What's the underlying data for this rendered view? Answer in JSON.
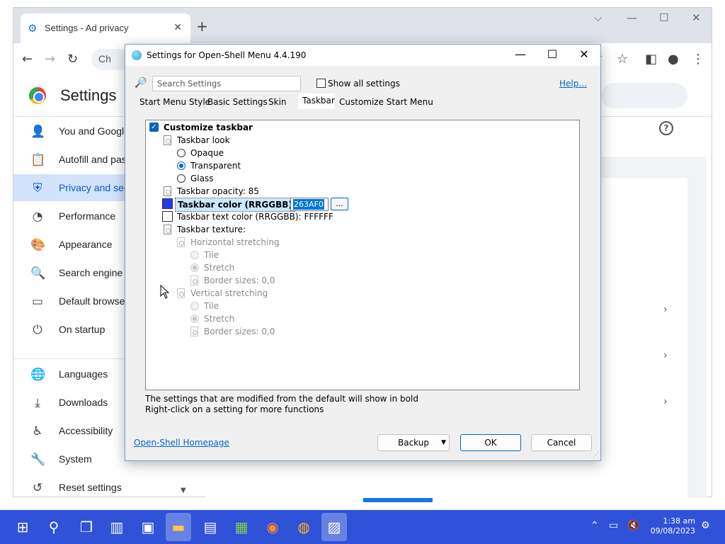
{
  "browser": {
    "tab_title": "Settings - Ad privacy",
    "omnibox_text": "Ch",
    "settings_title": "Settings",
    "sidebar": [
      {
        "label": "You and Google",
        "icon": "person-icon"
      },
      {
        "label": "Autofill and passwords",
        "icon": "clipboard-icon"
      },
      {
        "label": "Privacy and security",
        "icon": "shield-icon",
        "active": true
      },
      {
        "label": "Performance",
        "icon": "gauge-icon"
      },
      {
        "label": "Appearance",
        "icon": "palette-icon"
      },
      {
        "label": "Search engine",
        "icon": "search-icon"
      },
      {
        "label": "Default browser",
        "icon": "browser-icon"
      },
      {
        "label": "On startup",
        "icon": "power-icon"
      },
      {
        "label": "Languages",
        "icon": "globe-icon"
      },
      {
        "label": "Downloads",
        "icon": "download-icon"
      },
      {
        "label": "Accessibility",
        "icon": "accessibility-icon"
      },
      {
        "label": "System",
        "icon": "wrench-icon"
      },
      {
        "label": "Reset settings",
        "icon": "history-icon"
      }
    ]
  },
  "dialog": {
    "title": "Settings for Open-Shell Menu 4.4.190",
    "search_placeholder": "Search Settings",
    "show_all_label": "Show all settings",
    "help_link": "Help...",
    "tabs": [
      "Start Menu Style",
      "Basic Settings",
      "Skin",
      "Taskbar",
      "Customize Start Menu"
    ],
    "selected_tab": "Taskbar",
    "tree": {
      "customize_taskbar": "Customize taskbar",
      "taskbar_look": "Taskbar look",
      "opaque": "Opaque",
      "transparent": "Transparent",
      "glass": "Glass",
      "opacity": "Taskbar opacity: 85",
      "color_label": "Taskbar color (RRGGBB)",
      "color_value": "263AF0",
      "color_button": "...",
      "text_color": "Taskbar text color (RRGGBB): FFFFFF",
      "texture": "Taskbar texture:",
      "h_stretch": "Horizontal stretching",
      "h_tile": "Tile",
      "h_stretch_opt": "Stretch",
      "h_border": "Border sizes: 0,0",
      "v_stretch": "Vertical stretching",
      "v_tile": "Tile",
      "v_stretch_opt": "Stretch",
      "v_border": "Border sizes: 0,0"
    },
    "swatch_colors": {
      "taskbar": "#263AF0",
      "text": "#FFFFFF"
    },
    "note1": "The settings that are modified from the default will show in bold",
    "note2": "Right-click on a setting for more functions",
    "homepage_link": "Open-Shell Homepage",
    "buttons": {
      "backup": "Backup",
      "ok": "OK",
      "cancel": "Cancel"
    }
  },
  "taskbar": {
    "time": "1:38 am",
    "date": "09/08/2023"
  }
}
